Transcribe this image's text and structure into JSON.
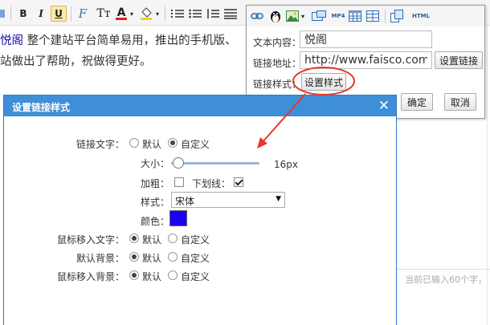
{
  "editor": {
    "text_link": "悦阁",
    "text_line1": " 整个建站平台简单易用，推出的手机版、",
    "text_line2": "站做出了帮助，祝做得更好。",
    "status_text": "当前已输入60个字，"
  },
  "toolbar": {
    "bold_label": "B",
    "italic_label": "I",
    "underline_label": "U",
    "clear_format_label": "F",
    "font_size_label": "Tт",
    "font_color_label": "A",
    "font_color": "#e02020",
    "mp4_label": "MP4",
    "html_label": "HTML"
  },
  "link_popup": {
    "text_label": "文本内容：",
    "text_value": "悦阁",
    "url_label": "链接地址：",
    "url_value": "http://www.faisco.com",
    "set_link_button": "设置链接",
    "style_label": "链接样式：",
    "set_style_button": "设置样式",
    "ok_button": "确定",
    "cancel_button": "取消"
  },
  "annotation": {
    "color": "#e8362c"
  },
  "dialog": {
    "title": "设置链接样式",
    "close_glyph": "✕",
    "header_color": "#3e8ed8",
    "link_text_label": "链接文字：",
    "option_default": "默认",
    "option_custom": "自定义",
    "size_label": "大小：",
    "size_value": "16px",
    "size_fraction": 0.08,
    "bold_label": "加粗：",
    "bold_checked": false,
    "underline_label": "下划线：",
    "underline_checked": true,
    "style_label": "样式：",
    "font_value": "宋体",
    "color_label": "颜色：",
    "swatch_color": "#1a00f5",
    "hover_text_label": "鼠标移入文字：",
    "default_bg_label": "默认背景：",
    "hover_bg_label": "鼠标移入背景："
  }
}
